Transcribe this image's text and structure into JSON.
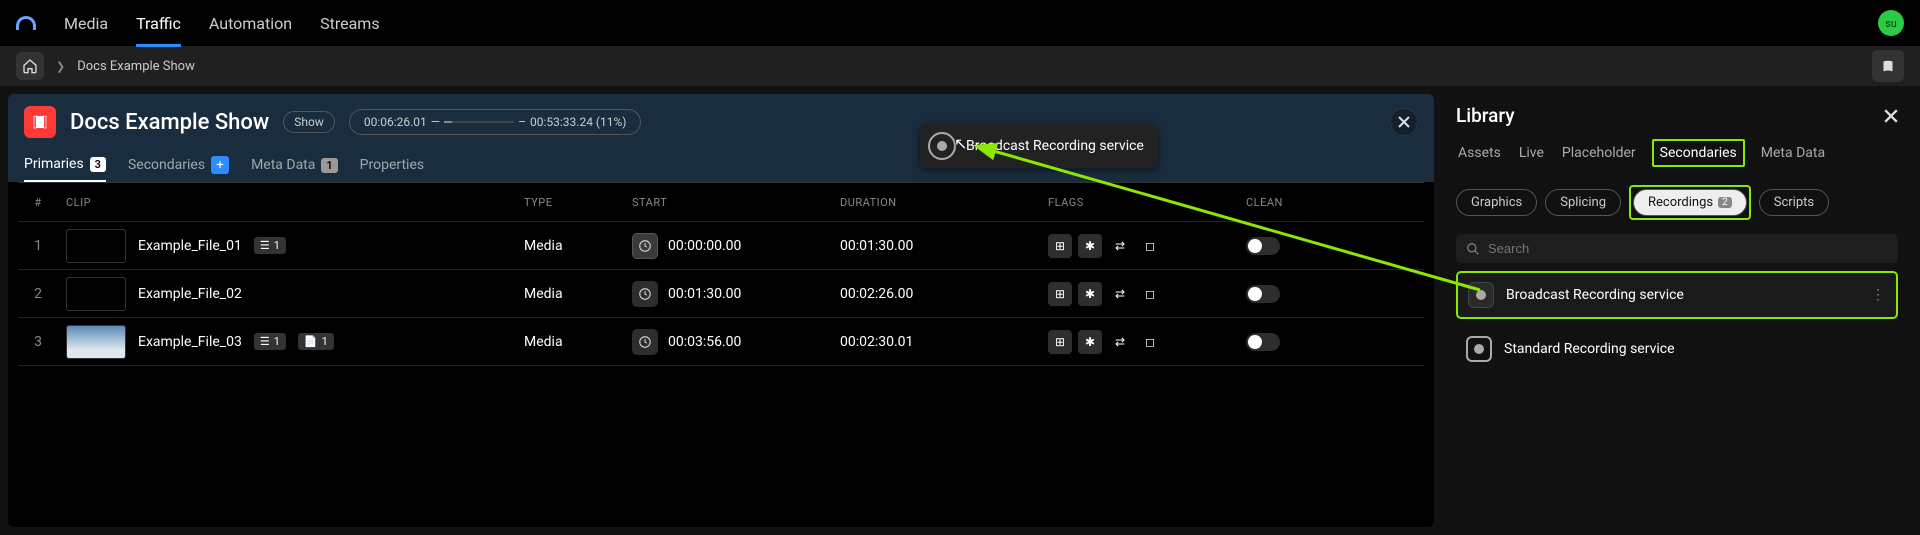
{
  "nav": {
    "items": [
      "Media",
      "Traffic",
      "Automation",
      "Streams"
    ],
    "active": 1,
    "avatar": "su"
  },
  "breadcrumb": {
    "item": "Docs Example Show"
  },
  "editor": {
    "title": "Docs Example Show",
    "show_label": "Show",
    "time_start": "00:06:26.01",
    "time_end": "00:53:33.24 (11%)",
    "tabs": [
      {
        "label": "Primaries",
        "badge": "3",
        "active": true
      },
      {
        "label": "Secondaries",
        "add": true
      },
      {
        "label": "Meta Data",
        "badge": "1"
      },
      {
        "label": "Properties"
      }
    ],
    "drag_label": "Broadcast Recording service"
  },
  "table": {
    "headers": {
      "num": "#",
      "clip": "CLIP",
      "type": "TYPE",
      "start": "START",
      "duration": "DURATION",
      "flags": "FLAGS",
      "clean": "CLEAN"
    },
    "rows": [
      {
        "num": "1",
        "clip": "Example_File_01",
        "badge1": "1",
        "type": "Media",
        "start": "00:00:00.00",
        "duration": "00:01:30.00",
        "thumb": "black",
        "clock_bordered": true
      },
      {
        "num": "2",
        "clip": "Example_File_02",
        "type": "Media",
        "start": "00:01:30.00",
        "duration": "00:02:26.00",
        "thumb": "black"
      },
      {
        "num": "3",
        "clip": "Example_File_03",
        "badge1": "1",
        "badge2": "1",
        "type": "Media",
        "start": "00:03:56.00",
        "duration": "00:02:30.01",
        "thumb": "sky",
        "clock_bordered": true
      }
    ]
  },
  "library": {
    "title": "Library",
    "tabs": [
      "Assets",
      "Live",
      "Placeholder",
      "Secondaries",
      "Meta Data"
    ],
    "active_tab": 3,
    "sub_pills": [
      {
        "label": "Graphics"
      },
      {
        "label": "Splicing"
      },
      {
        "label": "Recordings",
        "badge": "2",
        "active": true,
        "highlight": true
      },
      {
        "label": "Scripts"
      }
    ],
    "search_placeholder": "Search",
    "items": [
      {
        "label": "Broadcast Recording service",
        "highlight": true,
        "drag": true
      },
      {
        "label": "Standard Recording service"
      }
    ]
  }
}
